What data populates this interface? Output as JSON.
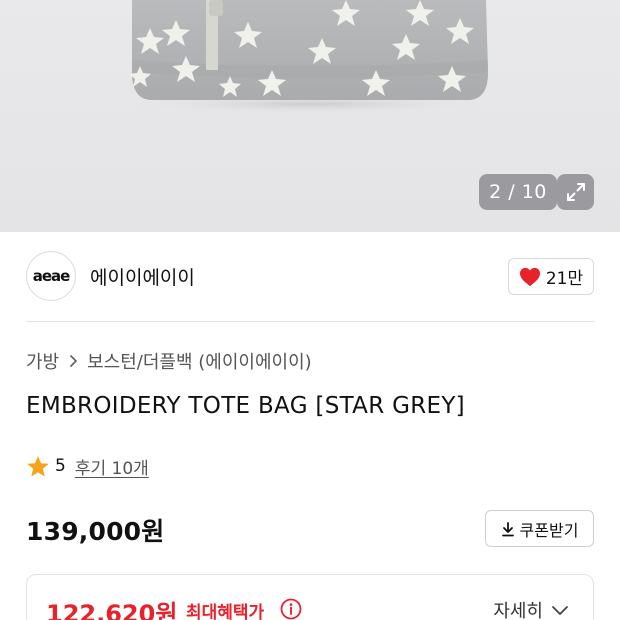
{
  "gallery": {
    "counter": "2 / 10",
    "expand_icon": "expand-icon"
  },
  "brand": {
    "logo_text": "aeae",
    "name": "에이이에이이",
    "like_count": "21만",
    "like_icon": "heart-icon",
    "like_color": "#e8212b"
  },
  "breadcrumb": {
    "items": [
      "가방",
      "보스턴/더플백 (에이이에이이)"
    ],
    "separator_icon": "chevron-right-icon"
  },
  "product": {
    "title": "EMBROIDERY TOTE BAG [STAR GREY]"
  },
  "rating": {
    "score": "5",
    "review_text": "후기 10개",
    "star_color": "#f4a41c"
  },
  "price": {
    "original": "139,000원",
    "coupon_label": "쿠폰받기",
    "coupon_icon": "download-icon"
  },
  "benefit": {
    "price": "122,620원",
    "label": "최대혜택가",
    "info_icon": "info-icon",
    "detail_label": "자세히",
    "detail_icon": "chevron-down-icon",
    "accent_color": "#e8212b"
  }
}
